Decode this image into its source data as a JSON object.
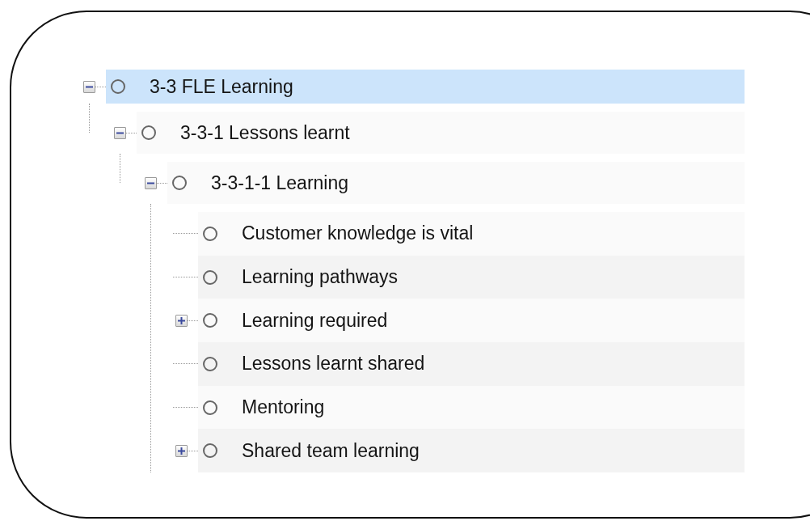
{
  "tree": [
    {
      "label": "3-3 FLE Learning",
      "selected": true,
      "expanded": true,
      "children": [
        {
          "label": "3-3-1 Lessons learnt",
          "selected": false,
          "expanded": true,
          "children": [
            {
              "label": "3-3-1-1 Learning",
              "selected": false,
              "expanded": true,
              "children": [
                {
                  "label": "Customer knowledge is vital",
                  "selected": false
                },
                {
                  "label": "Learning pathways",
                  "selected": false
                },
                {
                  "label": "Learning required",
                  "selected": false,
                  "expanded": false
                },
                {
                  "label": "Lessons learnt shared",
                  "selected": false
                },
                {
                  "label": "Mentoring",
                  "selected": false
                },
                {
                  "label": "Shared team learning",
                  "selected": false,
                  "expanded": false
                }
              ]
            }
          ]
        }
      ]
    }
  ]
}
